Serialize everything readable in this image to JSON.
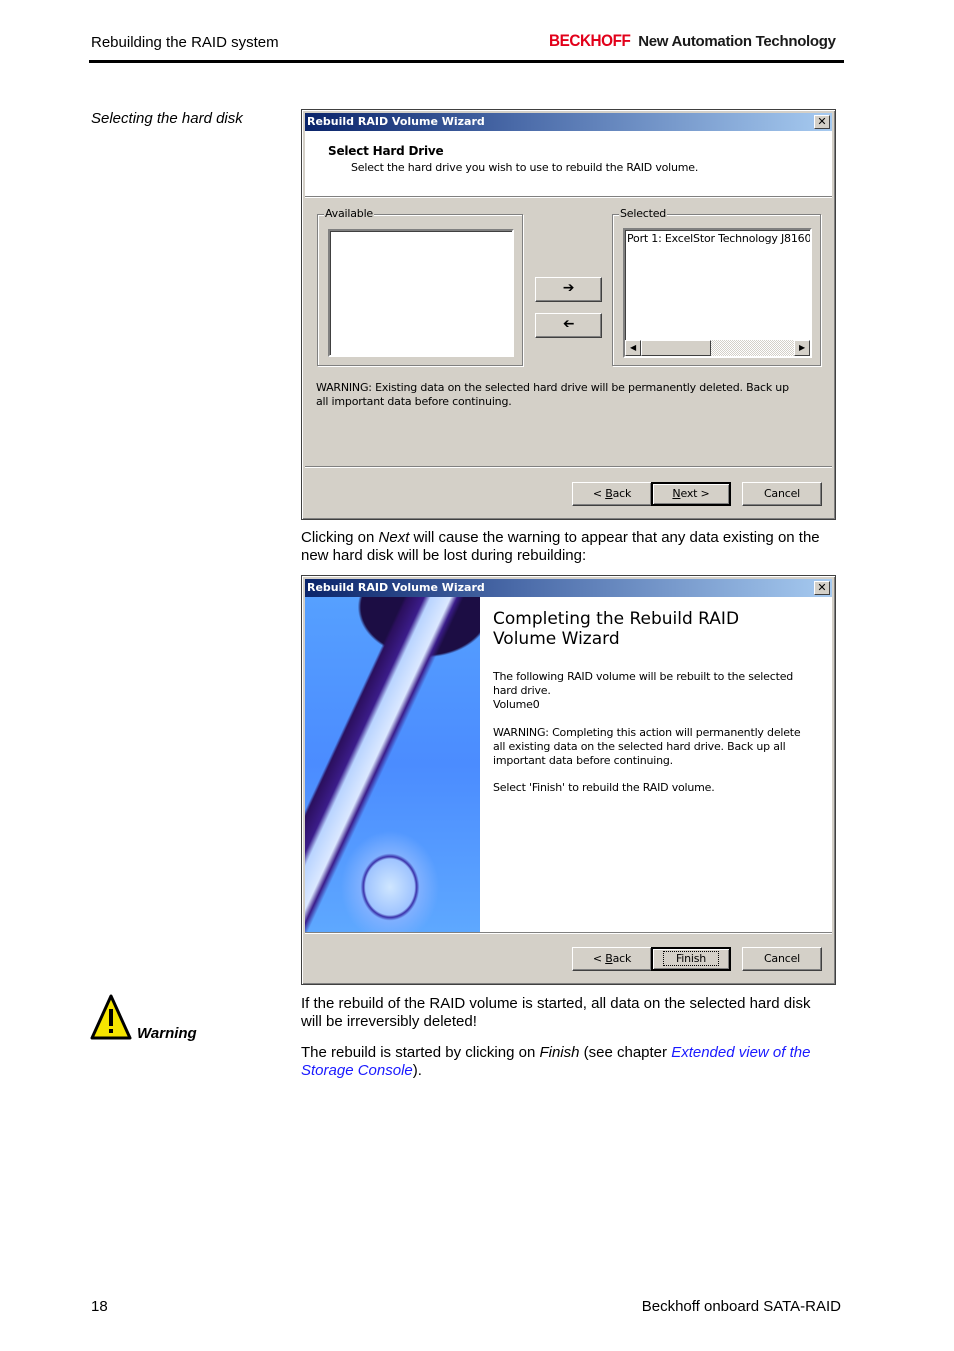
{
  "header": {
    "section_title": "Rebuilding the RAID system",
    "brand_logo": "BECKHOFF",
    "brand_tagline": "New Automation Technology"
  },
  "side_label": "Selecting the hard disk",
  "dialog1": {
    "title": "Rebuild RAID Volume Wizard",
    "close_icon": "close-icon",
    "heading": "Select Hard Drive",
    "subheading": "Select the hard drive you wish to use to rebuild the RAID volume.",
    "available_label": "Available",
    "available_items": [],
    "selected_label": "Selected",
    "selected_items": [
      "Port 1: ExcelStor Technology J8160"
    ],
    "add_button_icon": "arrow-right-icon",
    "remove_button_icon": "arrow-left-icon",
    "warning": "WARNING: Existing data on the selected hard drive will be permanently deleted. Back up all important data before continuing.",
    "buttons": {
      "back_prefix": "< ",
      "back_accel": "B",
      "back_rest": "ack",
      "next_accel": "N",
      "next_rest": "ext >",
      "cancel": "Cancel"
    }
  },
  "paragraph1": {
    "before": "Clicking on ",
    "emph": "Next",
    "after": " will cause the warning to appear that any data existing on the new hard disk will be lost during rebuilding:"
  },
  "dialog2": {
    "title": "Rebuild RAID Volume Wizard",
    "close_icon": "close-icon",
    "image": "hard-disk-image",
    "heading": "Completing the Rebuild RAID Volume Wizard",
    "line1": "The following RAID volume will be rebuilt to the selected hard drive.",
    "volume": "Volume0",
    "warning": "WARNING: Completing this action will permanently delete all existing data on the selected hard drive. Back up all important data before continuing.",
    "instruction": "Select 'Finish' to rebuild the RAID volume.",
    "buttons": {
      "back_prefix": "< ",
      "back_accel": "B",
      "back_rest": "ack",
      "finish": "Finish",
      "cancel": "Cancel"
    }
  },
  "warning_note": {
    "icon": "warning-triangle-icon",
    "label": "Warning",
    "text": "If the rebuild of the RAID volume is started, all data on the selected hard disk will be irreversibly deleted!"
  },
  "paragraph2": {
    "before": "The rebuild is started by clicking on ",
    "emph": "Finish",
    "middle": " (see chapter ",
    "link": "Extended view of the Storage Console",
    "after": ")."
  },
  "footer": {
    "page_number": "18",
    "doc_title": "Beckhoff onboard SATA-RAID"
  },
  "colors": {
    "brand_red": "#e2001a",
    "link_blue": "#1a1aff",
    "dialog_face": "#d4d0c8",
    "titlebar_start": "#0a246a",
    "titlebar_end": "#a6caf0"
  }
}
